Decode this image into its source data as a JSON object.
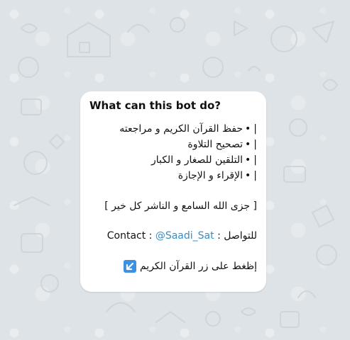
{
  "bot_info": {
    "title": "What can this bot do?",
    "lines": [
      {
        "bar": "|",
        "bullet": "•",
        "text": "حفظ القرآن الكريم و مراجعته"
      },
      {
        "bar": "|",
        "bullet": "•",
        "text": "تصحيح التلاوة"
      },
      {
        "bar": "|",
        "bullet": "•",
        "text": "التلقين للصغار و الكبار"
      },
      {
        "bar": "|",
        "bullet": "•",
        "text": "الإقراء و الإجازة"
      }
    ],
    "blessing": "[ جزى الله السامع و الناشر كل خير ]",
    "contact_prefix": "Contact :",
    "contact_handle": "@Saadi_Sat",
    "contact_arabic": ": للتواصل",
    "press_text": "إظغط على زر القرآن الكريم",
    "press_icon": "arrow-down-left-icon"
  },
  "colors": {
    "background": "#dde3e7",
    "card": "#ffffff",
    "link": "#3a8cc4",
    "icon_bg": "#3d8fe0"
  }
}
